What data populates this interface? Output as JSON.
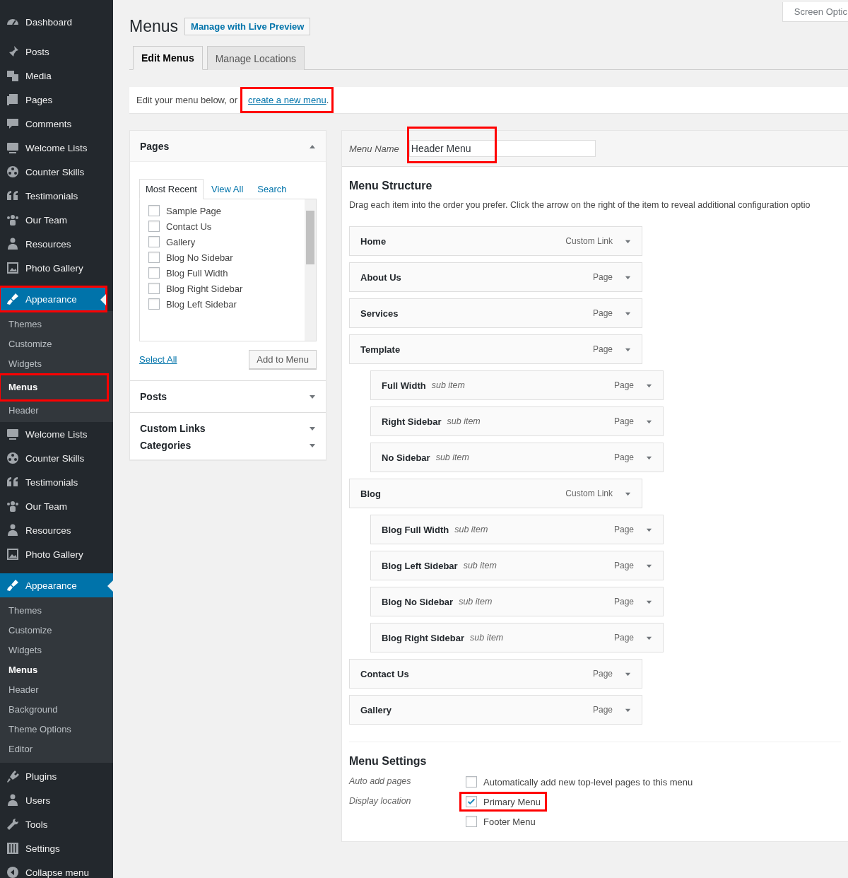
{
  "sidebar": {
    "groups": [
      {
        "items": [
          {
            "label": "Dashboard",
            "current": false,
            "highlighted": false
          },
          {
            "label": "Posts",
            "current": false,
            "highlighted": false
          },
          {
            "label": "Media",
            "current": false,
            "highlighted": false
          },
          {
            "label": "Pages",
            "current": false,
            "highlighted": false
          },
          {
            "label": "Comments",
            "current": false,
            "highlighted": false
          },
          {
            "label": "Welcome Lists",
            "current": false,
            "highlighted": false
          },
          {
            "label": "Counter Skills",
            "current": false,
            "highlighted": false
          },
          {
            "label": "Testimonials",
            "current": false,
            "highlighted": false
          },
          {
            "label": "Our Team",
            "current": false,
            "highlighted": false
          },
          {
            "label": "Resources",
            "current": false,
            "highlighted": false
          },
          {
            "label": "Photo Gallery",
            "current": false,
            "highlighted": false
          },
          {
            "label": "Appearance",
            "current": true,
            "highlighted": true,
            "submenu": [
              {
                "label": "Themes",
                "selected": false,
                "highlighted": false
              },
              {
                "label": "Customize",
                "selected": false,
                "highlighted": false
              },
              {
                "label": "Widgets",
                "selected": false,
                "highlighted": false
              },
              {
                "label": "Menus",
                "selected": true,
                "highlighted": true
              },
              {
                "label": "Header",
                "selected": false,
                "highlighted": false
              }
            ]
          }
        ]
      },
      {
        "items": [
          {
            "label": "Welcome Lists",
            "current": false,
            "highlighted": false
          },
          {
            "label": "Counter Skills",
            "current": false,
            "highlighted": false
          },
          {
            "label": "Testimonials",
            "current": false,
            "highlighted": false
          },
          {
            "label": "Our Team",
            "current": false,
            "highlighted": false
          },
          {
            "label": "Resources",
            "current": false,
            "highlighted": false
          },
          {
            "label": "Photo Gallery",
            "current": false,
            "highlighted": false
          },
          {
            "label": "Appearance",
            "current": true,
            "highlighted": false,
            "submenu": [
              {
                "label": "Themes",
                "selected": false,
                "highlighted": false
              },
              {
                "label": "Customize",
                "selected": false,
                "highlighted": false
              },
              {
                "label": "Widgets",
                "selected": false,
                "highlighted": false
              },
              {
                "label": "Menus",
                "selected": true,
                "highlighted": false
              },
              {
                "label": "Header",
                "selected": false,
                "highlighted": false
              },
              {
                "label": "Background",
                "selected": false,
                "highlighted": false
              },
              {
                "label": "Theme Options",
                "selected": false,
                "highlighted": false
              },
              {
                "label": "Editor",
                "selected": false,
                "highlighted": false
              }
            ]
          },
          {
            "label": "Plugins",
            "current": false,
            "highlighted": false
          },
          {
            "label": "Users",
            "current": false,
            "highlighted": false
          },
          {
            "label": "Tools",
            "current": false,
            "highlighted": false
          },
          {
            "label": "Settings",
            "current": false,
            "highlighted": false
          },
          {
            "label": "Collapse menu",
            "current": false,
            "highlighted": false
          }
        ]
      }
    ]
  },
  "screen_options": "Screen Optic",
  "title": "Menus",
  "live_preview_button": "Manage with Live Preview",
  "tabs": [
    {
      "label": "Edit Menus",
      "selected": true
    },
    {
      "label": "Manage Locations",
      "selected": false
    }
  ],
  "notice": {
    "text": "Edit your menu below, or",
    "link": "create a new menu",
    "link_highlighted": true,
    "after": "."
  },
  "pages_box": {
    "title": "Pages",
    "expanded": true,
    "tabs": [
      {
        "label": "Most Recent",
        "selected": true
      },
      {
        "label": "View All",
        "selected": false
      },
      {
        "label": "Search",
        "selected": false
      }
    ],
    "pages": [
      {
        "label": "Sample Page",
        "checked": false
      },
      {
        "label": "Contact Us",
        "checked": false
      },
      {
        "label": "Gallery",
        "checked": false
      },
      {
        "label": "Blog No Sidebar",
        "checked": false
      },
      {
        "label": "Blog Full Width",
        "checked": false
      },
      {
        "label": "Blog Right Sidebar",
        "checked": false
      },
      {
        "label": "Blog Left Sidebar",
        "checked": false
      }
    ],
    "select_all": "Select All",
    "add_button": "Add to Menu"
  },
  "other_boxes": [
    {
      "title": "Posts",
      "expanded": false
    },
    {
      "title": "Custom Links",
      "expanded": false
    },
    {
      "title": "Categories",
      "expanded": false
    }
  ],
  "menu_name": {
    "label": "Menu Name",
    "value": "Header Menu",
    "highlighted": true
  },
  "structure": {
    "title": "Menu Structure",
    "description": "Drag each item into the order you prefer. Click the arrow on the right of the item to reveal additional configuration optio",
    "items": [
      {
        "title": "Home",
        "type": "Custom Link"
      },
      {
        "title": "About Us",
        "type": "Page"
      },
      {
        "title": "Services",
        "type": "Page"
      },
      {
        "title": "Template",
        "type": "Page",
        "children": [
          {
            "title": "Full Width",
            "note": "sub item",
            "type": "Page"
          },
          {
            "title": "Right Sidebar",
            "note": "sub item",
            "type": "Page"
          },
          {
            "title": "No Sidebar",
            "note": "sub item",
            "type": "Page"
          }
        ]
      },
      {
        "title": "Blog",
        "type": "Custom Link",
        "children": [
          {
            "title": "Blog Full Width",
            "note": "sub item",
            "type": "Page"
          },
          {
            "title": "Blog Left Sidebar",
            "note": "sub item",
            "type": "Page"
          },
          {
            "title": "Blog No Sidebar",
            "note": "sub item",
            "type": "Page"
          },
          {
            "title": "Blog Right Sidebar",
            "note": "sub item",
            "type": "Page"
          }
        ]
      },
      {
        "title": "Contact Us",
        "type": "Page"
      },
      {
        "title": "Gallery",
        "type": "Page"
      }
    ]
  },
  "settings": {
    "title": "Menu Settings",
    "rows": [
      {
        "label": "Auto add pages",
        "options": [
          {
            "label": "Automatically add new top-level pages to this menu",
            "checked": false,
            "highlighted": false
          }
        ]
      },
      {
        "label": "Display location",
        "options": [
          {
            "label": "Primary Menu",
            "checked": true,
            "highlighted": true
          },
          {
            "label": "Footer Menu",
            "checked": false,
            "highlighted": false
          }
        ]
      }
    ]
  }
}
